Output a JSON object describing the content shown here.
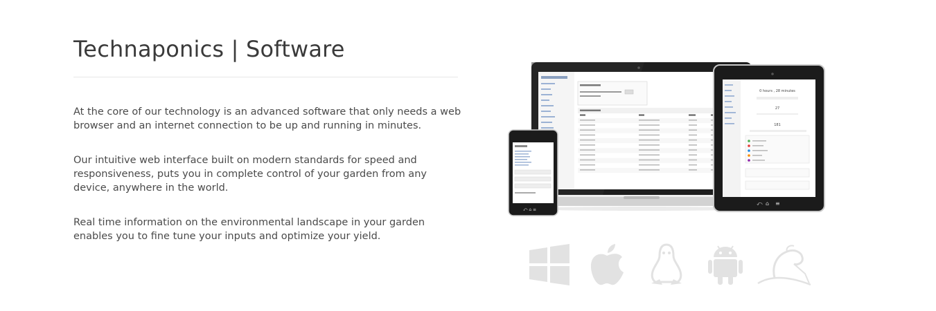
{
  "header": {
    "title": "Technaponics | Software"
  },
  "content": {
    "paragraphs": [
      "At the core of our technology is an advanced software that only needs a web browser and an internet connection to be up and running in minutes.",
      "Our intuitive web interface built on modern standards for speed and responsiveness, puts you in complete control of your garden from any device, anywhere in the world.",
      "Real time information on the environmental landscape in your garden enables you to fine tune your inputs and optimize your yield."
    ]
  },
  "showcase": {
    "tablet_readout": {
      "time": "0 hours , 28 minutes",
      "count_a": "27",
      "count_b": "181"
    },
    "colors": {
      "device_dark": "#1b1b1b",
      "device_silver": "#c9c9c9",
      "os_icon": "#e2e2e2"
    }
  },
  "platforms": {
    "icons": [
      "windows-icon",
      "apple-icon",
      "linux-icon",
      "android-icon",
      "kali-icon"
    ]
  }
}
